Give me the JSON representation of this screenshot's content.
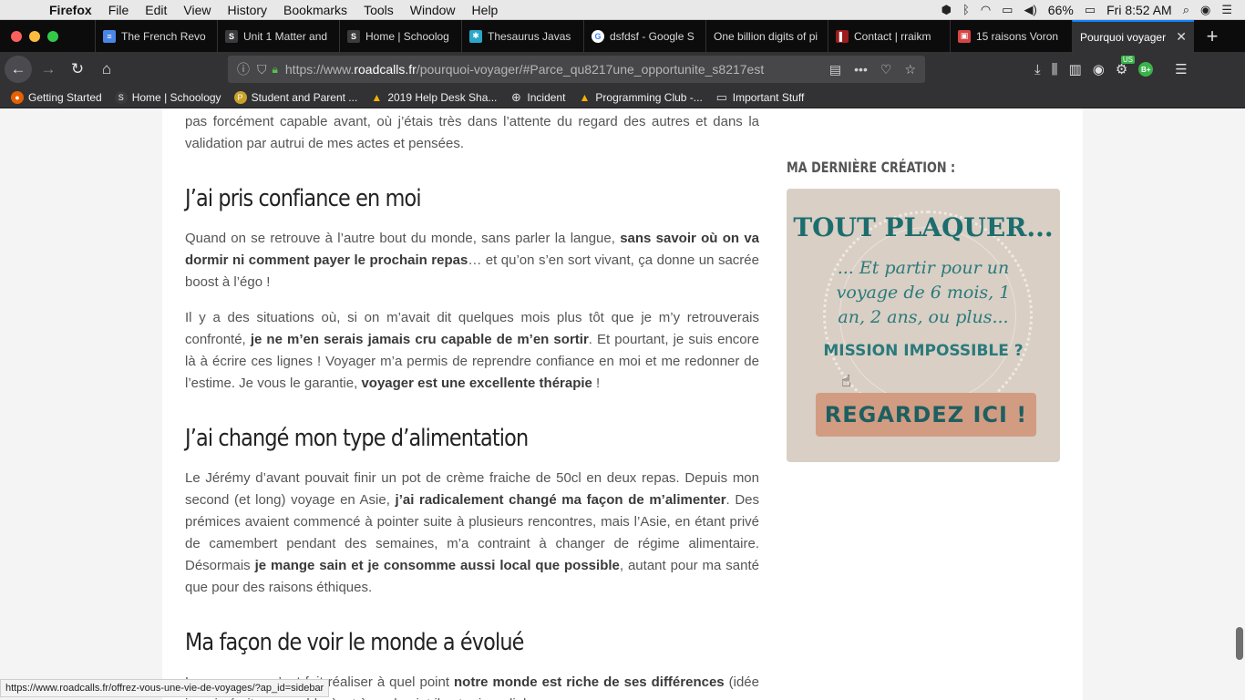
{
  "menubar": {
    "app": "Firefox",
    "items": [
      "File",
      "Edit",
      "View",
      "History",
      "Bookmarks",
      "Tools",
      "Window",
      "Help"
    ],
    "battery": "66%",
    "clock": "Fri 8:52 AM"
  },
  "tabs": [
    {
      "label": "The French Revo",
      "icon": "docs-icon",
      "color": "#4a86e8",
      "glyph": "≡"
    },
    {
      "label": "Unit 1 Matter and",
      "icon": "schoology-icon",
      "color": "#3b3b3d",
      "glyph": "S"
    },
    {
      "label": "Home | Schoolog",
      "icon": "schoology-icon",
      "color": "#3b3b3d",
      "glyph": "S"
    },
    {
      "label": "Thesaurus Javas",
      "icon": "thesaurus-icon",
      "color": "#2aa7c9",
      "glyph": "✱"
    },
    {
      "label": "dsfdsf - Google S",
      "icon": "google-icon",
      "color": "#ffffff",
      "glyph": "G"
    },
    {
      "label": "One billion digits of pi",
      "icon": "",
      "color": "",
      "glyph": ""
    },
    {
      "label": "Contact | rraikm",
      "icon": "contact-icon",
      "color": "#9b1c1c",
      "glyph": "▌"
    },
    {
      "label": "15 raisons Voron",
      "icon": "roadcalls-icon",
      "color": "#d64545",
      "glyph": "▣"
    },
    {
      "label": "Pourquoi voyager",
      "icon": "",
      "color": "",
      "glyph": "",
      "active": true
    }
  ],
  "navbar": {
    "url_prefix": "https://www.",
    "url_domain": "roadcalls.fr",
    "url_rest": "/pourquoi-voyager/#Parce_qu8217une_opportunite_s8217est",
    "us_badge": "US",
    "bplus_badge": "B+"
  },
  "bookmarks": [
    {
      "label": "Getting Started",
      "icon": "firefox-icon",
      "color": "#e66000",
      "glyph": "●"
    },
    {
      "label": "Home | Schoology",
      "icon": "schoology-icon",
      "color": "#3b3b3d",
      "glyph": "S"
    },
    {
      "label": "Student and Parent ...",
      "icon": "parent-icon",
      "color": "#c9a227",
      "glyph": "P"
    },
    {
      "label": "2019 Help Desk Sha...",
      "icon": "drive-icon",
      "color": "#f4b400",
      "glyph": "▲"
    },
    {
      "label": "Incident",
      "icon": "globe-icon",
      "color": "#777",
      "glyph": "⊕"
    },
    {
      "label": "Programming Club -...",
      "icon": "drive-icon",
      "color": "#f4b400",
      "glyph": "▲"
    },
    {
      "label": "Important Stuff",
      "icon": "folder-icon",
      "color": "",
      "glyph": "▭"
    }
  ],
  "article": {
    "intro": "pas forcément capable avant, où j’étais très dans l’attente du regard des autres et dans la validation par autrui de mes actes et pensées.",
    "h1": "J’ai pris confiance en moi",
    "p1a": "Quand on se retrouve à l’autre bout du monde, sans parler la langue, ",
    "p1b": "sans savoir où on va dormir ni comment payer le prochain repas",
    "p1c": "… et qu’on s’en sort vivant, ça donne un sacrée boost à l’égo !",
    "p2a": "Il y a des situations où, si on m’avait dit quelques mois plus tôt que je m’y retrouverais confronté, ",
    "p2b": "je ne m’en serais jamais cru capable de m’en sortir",
    "p2c": ". Et pourtant, je suis encore là à écrire ces lignes ! Voyager m’a permis de reprendre confiance en moi et me redonner de l’estime. Je vous le garantie, ",
    "p2d": "voyager est une excellente thérapie",
    "p2e": " !",
    "h2": "J’ai changé mon type d’alimentation",
    "p3a": "Le Jérémy d’avant pouvait finir un pot de crème fraiche de 50cl en deux repas. Depuis mon second (et long) voyage en Asie, ",
    "p3b": "j’ai radicalement changé ma façon de m’alimenter",
    "p3c": ". Des prémices avaient commencé à pointer suite à plusieurs rencontres, mais l’Asie, en étant privé de camembert pendant des semaines, m’a contraint à changer de régime alimentaire. Désormais ",
    "p3d": "je mange sain et je consomme aussi local que possible",
    "p3e": ", autant pour ma santé que pour des raisons éthiques.",
    "h3": "Ma façon de voir le monde a évolué",
    "p4a": "Les voyages m’ont fait réaliser à quel point ",
    "p4b": "notre monde est riche de ses différences",
    "p4c": " (idée jamais écrite sur ce blog), et à quel point il est primordial"
  },
  "sidebar": {
    "title": "MA DERNIÈRE CRÉATION :",
    "promo_line1": "TOUT PLAQUER...",
    "promo_line2": "... Et partir pour un voyage de 6 mois, 1 an, 2 ans, ou plus...",
    "promo_line3": "MISSION IMPOSSIBLE ?",
    "promo_button": "REGARDEZ ICI !"
  },
  "statusbar": {
    "url": "https://www.roadcalls.fr/offrez-vous-une-vie-de-voyages/?ap_id=sidebar"
  }
}
